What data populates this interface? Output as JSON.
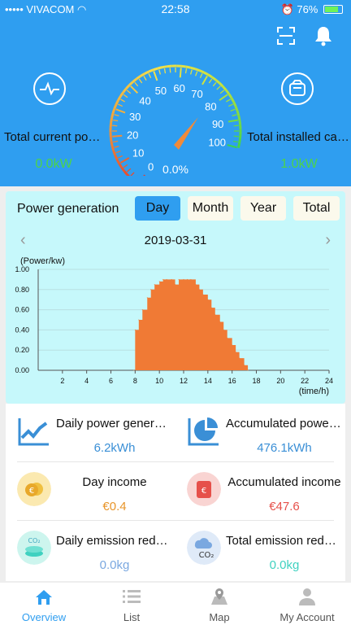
{
  "status_bar": {
    "carrier": "VIVACOM",
    "time": "22:58",
    "battery": "76%"
  },
  "header": {
    "current_power_label": "Total current power",
    "current_power_value": "0.0kW",
    "installed_capacity_label": "Total installed capacity",
    "installed_capacity_value": "1.0kW",
    "gauge_percent": "0.0%",
    "gauge_ticks": [
      "0",
      "10",
      "20",
      "30",
      "40",
      "50",
      "60",
      "70",
      "80",
      "90",
      "100"
    ]
  },
  "power_panel": {
    "title": "Power generation",
    "tabs": [
      "Day",
      "Month",
      "Year",
      "Total"
    ],
    "active_tab": "Day",
    "date": "2019-03-31"
  },
  "chart_data": {
    "type": "area",
    "ylabel": "(Power/kw)",
    "xlabel": "(time/h)",
    "xlim": [
      0,
      24
    ],
    "ylim": [
      0,
      1.0
    ],
    "x_ticks": [
      "2",
      "4",
      "6",
      "8",
      "10",
      "12",
      "14",
      "16",
      "18",
      "20",
      "22",
      "24"
    ],
    "y_ticks": [
      "0.00",
      "0.20",
      "0.40",
      "0.60",
      "0.80",
      "1.00"
    ],
    "color": "#f07a35",
    "x": [
      7.9,
      8.0,
      8.3,
      8.6,
      9.0,
      9.3,
      9.6,
      10.0,
      10.3,
      10.6,
      11.0,
      11.3,
      11.6,
      12.0,
      12.3,
      12.6,
      13.0,
      13.3,
      13.6,
      14.0,
      14.3,
      14.6,
      15.0,
      15.3,
      15.6,
      16.0,
      16.3,
      16.6,
      17.0,
      17.3
    ],
    "y": [
      0.0,
      0.4,
      0.5,
      0.6,
      0.72,
      0.8,
      0.85,
      0.88,
      0.9,
      0.9,
      0.9,
      0.85,
      0.9,
      0.9,
      0.9,
      0.9,
      0.85,
      0.8,
      0.75,
      0.7,
      0.62,
      0.55,
      0.48,
      0.4,
      0.32,
      0.25,
      0.18,
      0.12,
      0.05,
      0.0
    ]
  },
  "stats": [
    {
      "label": "Daily power generation",
      "value": "6.2kWh",
      "color": "#3a8fd6",
      "icon": "line-chart-icon"
    },
    {
      "label": "Accumulated power generation",
      "value": "476.1kWh",
      "color": "#3a8fd6",
      "icon": "pie-chart-icon"
    },
    {
      "label": "Day income",
      "value": "€0.4",
      "color": "#e8952a",
      "icon": "coins-icon"
    },
    {
      "label": "Accumulated income",
      "value": "€47.6",
      "color": "#e6504a",
      "icon": "wallet-icon"
    },
    {
      "label": "Daily emission reduction",
      "value": "0.0kg",
      "color": "#7aa8e0",
      "icon": "co2-stack-icon"
    },
    {
      "label": "Total emission reduction",
      "value": "0.0kg",
      "color": "#3fd1c0",
      "icon": "co2-cloud-icon"
    }
  ],
  "bottom_nav": [
    {
      "label": "Overview",
      "icon": "home-icon"
    },
    {
      "label": "List",
      "icon": "list-icon"
    },
    {
      "label": "Map",
      "icon": "map-icon"
    },
    {
      "label": "My Account",
      "icon": "user-icon"
    }
  ]
}
